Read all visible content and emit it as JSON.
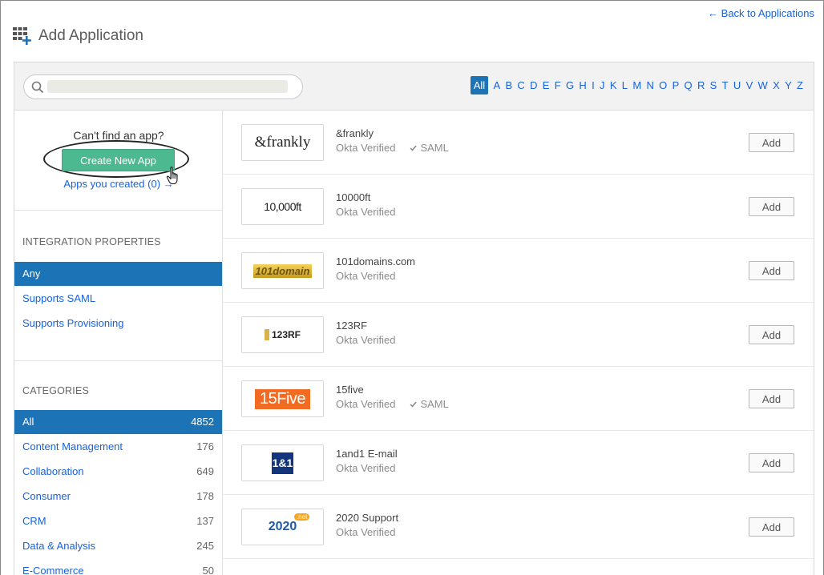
{
  "header": {
    "back_link": "← Back to Applications",
    "title": "Add Application"
  },
  "search": {
    "placeholder": "",
    "value": ""
  },
  "alphabet": {
    "active": "All",
    "letters": [
      "A",
      "B",
      "C",
      "D",
      "E",
      "F",
      "G",
      "H",
      "I",
      "J",
      "K",
      "L",
      "M",
      "N",
      "O",
      "P",
      "Q",
      "R",
      "S",
      "T",
      "U",
      "V",
      "W",
      "X",
      "Y",
      "Z"
    ]
  },
  "sidebar": {
    "cant_find": "Can't find an app?",
    "create_button": "Create New App",
    "apps_created": "Apps you created (0) →",
    "integration_label": "INTEGRATION PROPERTIES",
    "integration_items": [
      {
        "label": "Any"
      },
      {
        "label": "Supports SAML"
      },
      {
        "label": "Supports Provisioning"
      }
    ],
    "categories_label": "CATEGORIES",
    "categories": [
      {
        "label": "All",
        "count": "4852"
      },
      {
        "label": "Content Management",
        "count": "176"
      },
      {
        "label": "Collaboration",
        "count": "649"
      },
      {
        "label": "Consumer",
        "count": "178"
      },
      {
        "label": "CRM",
        "count": "137"
      },
      {
        "label": "Data & Analysis",
        "count": "245"
      },
      {
        "label": "E-Commerce",
        "count": "50"
      }
    ]
  },
  "apps": [
    {
      "name": "&frankly",
      "verified": "Okta Verified",
      "saml": "SAML",
      "logo": "&frankly",
      "add": "Add"
    },
    {
      "name": "10000ft",
      "verified": "Okta Verified",
      "saml": "",
      "logo": "10,000ft",
      "add": "Add"
    },
    {
      "name": "101domains.com",
      "verified": "Okta Verified",
      "saml": "",
      "logo": "101domain",
      "add": "Add"
    },
    {
      "name": "123RF",
      "verified": "Okta Verified",
      "saml": "",
      "logo": "123RF",
      "add": "Add"
    },
    {
      "name": "15five",
      "verified": "Okta Verified",
      "saml": "SAML",
      "logo": "15Five",
      "add": "Add"
    },
    {
      "name": "1and1 E-mail",
      "verified": "Okta Verified",
      "saml": "",
      "logo": "1&1",
      "add": "Add"
    },
    {
      "name": "2020 Support",
      "verified": "Okta Verified",
      "saml": "",
      "logo": "2020",
      "logo_badge": ".net",
      "add": "Add"
    }
  ],
  "colors": {
    "link": "#1662dd",
    "active_blue": "#1c73b6",
    "create_green": "#4cb991"
  }
}
